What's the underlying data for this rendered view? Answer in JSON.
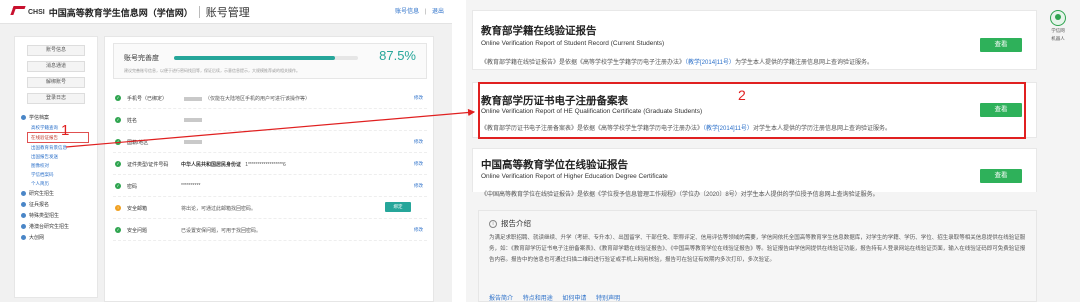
{
  "left": {
    "header": {
      "site_short": "CHSI",
      "site_name": "中国高等教育学生信息网（学信网）",
      "page_title": "账号管理",
      "links": [
        "账号信息",
        "|",
        "退出"
      ]
    },
    "sidebar": {
      "buttons": [
        "账号信息",
        "消息通道",
        "解绑账号",
        "登录日志"
      ],
      "groups": [
        {
          "label": "学信档案",
          "subs": [
            "高校学籍查询",
            "在线验证报告",
            "出国教育背景信息",
            "出国报告发送",
            "图像校对",
            "学信档案码",
            "个人简历"
          ]
        },
        {
          "label": "研究生招生",
          "subs": []
        },
        {
          "label": "征兵报名",
          "subs": []
        },
        {
          "label": "特殊类型招生",
          "subs": []
        },
        {
          "label": "港澳台研究生招生",
          "subs": []
        },
        {
          "label": "大创网",
          "subs": []
        }
      ],
      "active_sub": "在线验证报告"
    },
    "completeness": {
      "label": "账号完善度",
      "percent_text": "87.5%",
      "percent_value": 0.875,
      "note": "建议完善账号信息，以便于进行密码找回等，保证后续，示意信息提示，大规模推荐或的相关操作。"
    },
    "rows": [
      {
        "label": "手机号（已绑定）",
        "value": "（仅能在大陆地区手机的用户可进行该操作等）",
        "edit": "修改"
      },
      {
        "label": "姓名",
        "value": "",
        "edit": ""
      },
      {
        "label": "国籍/地区",
        "value": "",
        "edit": "修改"
      },
      {
        "label": "证件类型/证件号码",
        "value_bold": "中华人民共和国居民身份证",
        "value": "1******************6",
        "edit": "修改"
      },
      {
        "label": "密码",
        "value": "**********",
        "edit": "修改"
      },
      {
        "label": "安全邮箱",
        "value": "将出论，可通过此邮箱找回密码。",
        "edit": "绑定"
      },
      {
        "label": "安全问题",
        "value": "已设置安保问题，可用于找回密码。",
        "edit": "修改"
      }
    ],
    "annotation": "1"
  },
  "right": {
    "cards": [
      {
        "title": "教育部学籍在线验证报告",
        "subtitle": "Online Verification Report of Student Record (Current Students)",
        "desc_a": "《教育部学籍在线验证报告》是依据《高等学校学生学籍学历电子注册办法》",
        "desc_link": "（教学[2014]11号）",
        "desc_b": "为学生本人提供的学籍注册信息网上查询验证服务。",
        "button": "查看"
      },
      {
        "title": "教育部学历证书电子注册备案表",
        "subtitle": "Online Verification Report of HE Qualification Certificate (Graduate Students)",
        "desc_a": "《教育部学历证书电子注册备案表》是依据《高等学校学生学籍学历电子注册办法》",
        "desc_link": "（教学[2014]11号）",
        "desc_b": "对学生本人提供的学历注册信息网上查询验证服务。",
        "button": "查看"
      },
      {
        "title": "中国高等教育学位在线验证报告",
        "subtitle": "Online Verification Report of Higher Education Degree Certificate",
        "desc_a": "《中国高等教育学位在线验证报告》是依据《学位授予信息管理工作规程》（学位办〔2020〕8号）对学生本人提供的学位授予信息网上查询验证服务。",
        "desc_link": "",
        "desc_b": "",
        "button": "查看"
      }
    ],
    "intro": {
      "heading": "报告介绍",
      "body": "为满足求职招聘、就读继续、升学（考研、专升本）、出国留学、干部任免、职称评定、信用评估等领域的需要，学信网依托全国高等教育学生信息数据库，对学生的学籍、学历、学位、招生录取等相关信息提供在线验证服务，如：《教育部学历证书电子注册备案表》、《教育部学籍在线验证报告》、《中国高等教育学位在线验证报告》等。验证报告由学信网提供在线验证功能，报告持有人登录网站在线验证页面，输入在线验证码即可免费验证报告内容。报告中的信息也可通过扫描二维码进行验证或手机上网用核验，报告可在验证有效期内多次打印，多次验证。",
      "links": [
        "报告简介",
        "特点和用途",
        "如何申请",
        "特别声明"
      ]
    },
    "widget": {
      "line1": "学信网",
      "line2": "机器人"
    },
    "annotation": "2"
  },
  "colors": {
    "accent_green": "#2eb15a",
    "teal": "#26a69a",
    "link_blue": "#2a6fc9",
    "annotation_red": "#e02020"
  }
}
